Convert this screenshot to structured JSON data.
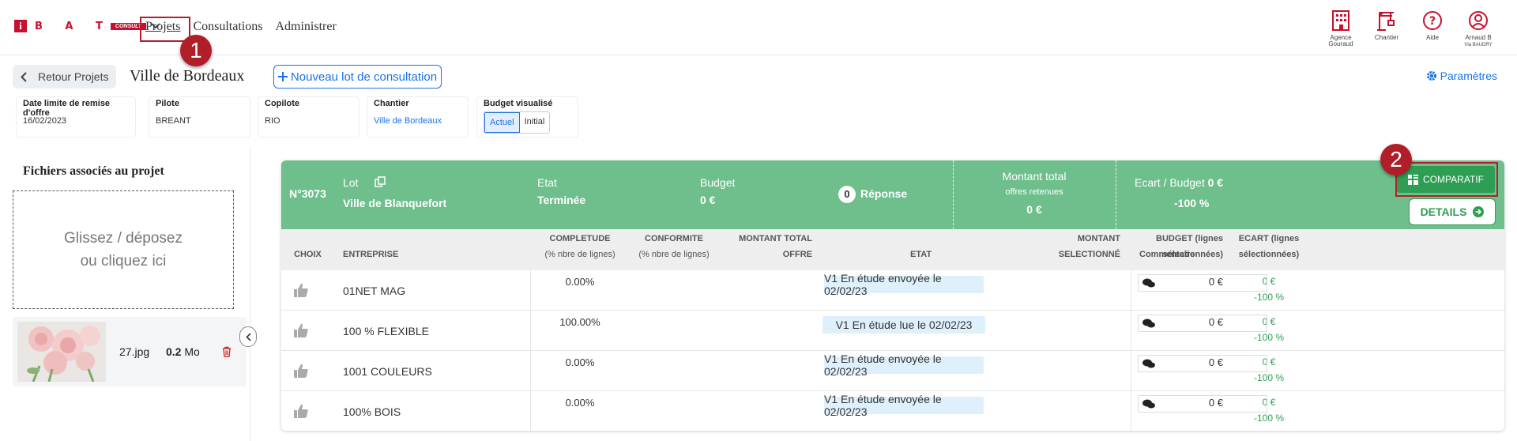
{
  "brand": {
    "letters": "B A T",
    "badge": "CONSULT",
    "i": "i"
  },
  "nav": {
    "projets": "Projets",
    "consultations": "Consultations",
    "administrer": "Administrer"
  },
  "annotations": {
    "one": "1",
    "two": "2"
  },
  "topright": [
    {
      "icon": "building-icon",
      "label": "Agence Gouraud"
    },
    {
      "icon": "crane-icon",
      "label": "Chantier"
    },
    {
      "icon": "help-icon",
      "label": "Aide"
    },
    {
      "icon": "user-icon",
      "label": "Arnaud B",
      "sub": "Via BAUDRY"
    }
  ],
  "back": "Retour Projets",
  "project_title": "Ville de Bordeaux",
  "new_lot": "Nouveau lot de consultation",
  "params": "Paramètres",
  "fields": {
    "date_label": "Date limite de remise d'offre",
    "date_value": "16/02/2023",
    "pilote_label": "Pilote",
    "pilote_value": "BREANT",
    "copilote_label": "Copilote",
    "copilote_value": "RIO",
    "chantier_label": "Chantier",
    "chantier_value": "Ville de Bordeaux",
    "budget_label": "Budget visualisé",
    "budget_actuel": "Actuel",
    "budget_initial": "Initial"
  },
  "files": {
    "title": "Fichiers associés au projet",
    "drop_line1": "Glissez / déposez",
    "drop_line2": "ou cliquez ici",
    "file_name": "27.jpg",
    "file_size": "0.2",
    "file_unit": "Mo"
  },
  "lot": {
    "number": "N°3073",
    "lot_label": "Lot",
    "lot_name": "Ville de Blanquefort",
    "etat_label": "Etat",
    "etat_value": "Terminée",
    "budget_label": "Budget",
    "budget_value": "0 €",
    "responses": "0",
    "responses_label": "Réponse",
    "montant_label": "Montant total",
    "montant_sub": "offres retenues",
    "montant_value": "0 €",
    "ecart_label": "Ecart / Budget",
    "ecart_amount": "0 €",
    "ecart_pct": "-100 %",
    "comparatif": "COMPARATIF",
    "details": "DETAILS"
  },
  "table": {
    "headers": {
      "choix": "CHOIX",
      "entreprise": "ENTREPRISE",
      "completude1": "COMPLETUDE",
      "completude2": "(% nbre de lignes)",
      "conformite1": "CONFORMITE",
      "conformite2": "(% nbre de lignes)",
      "montant1": "MONTANT TOTAL",
      "montant2": "OFFRE",
      "etat": "ETAT",
      "montsel1": "MONTANT",
      "montsel2": "SELECTIONNÉ",
      "budget1": "BUDGET (lignes",
      "budget2": "sélectionnées)",
      "ecart1": "ECART (lignes",
      "ecart2": "sélectionnées)",
      "commentaire": "Commentaire"
    },
    "rows": [
      {
        "entreprise": "01NET MAG",
        "completude": "0.00%",
        "etat": "V1 En étude envoyée le 02/02/23",
        "budget": "0 €",
        "ecart_amount": "0 €",
        "ecart_pct": "-100 %"
      },
      {
        "entreprise": "100 % FLEXIBLE",
        "completude": "100.00%",
        "etat": "V1 En étude lue le 02/02/23",
        "budget": "0 €",
        "ecart_amount": "0 €",
        "ecart_pct": "-100 %"
      },
      {
        "entreprise": "1001 COULEURS",
        "completude": "0.00%",
        "etat": "V1 En étude envoyée le 02/02/23",
        "budget": "0 €",
        "ecart_amount": "0 €",
        "ecart_pct": "-100 %"
      },
      {
        "entreprise": "100% BOIS",
        "completude": "0.00%",
        "etat": "V1 En étude envoyée le 02/02/23",
        "budget": "0 €",
        "ecart_amount": "0 €",
        "ecart_pct": "-100 %"
      }
    ]
  },
  "colors": {
    "brand_red": "#c8102e",
    "header_green": "#6ebf8b",
    "button_green": "#2e9e55",
    "link_blue": "#1a73e8"
  }
}
